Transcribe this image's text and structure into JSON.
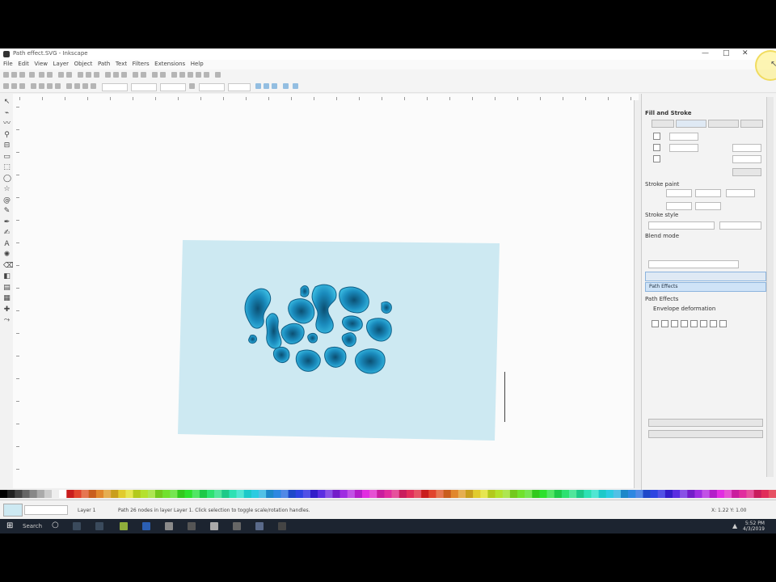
{
  "window": {
    "title": "Path effect.SVG - Inkscape",
    "controls": [
      "—",
      "□",
      "✕"
    ]
  },
  "menu": [
    "File",
    "Edit",
    "View",
    "Layer",
    "Object",
    "Path",
    "Text",
    "Filters",
    "Extensions",
    "Help"
  ],
  "colors": {
    "page_fill": "#cde9f2",
    "shape_dark": "#0b4f72",
    "shape_mid": "#1a8bbd",
    "shape_light": "#3fc3e8",
    "taskbar": "#1c2430",
    "selection_blue": "#cfe3f7"
  },
  "toolbox": {
    "tools": [
      "select-icon",
      "node-icon",
      "tweak-icon",
      "zoom-icon",
      "measure-icon",
      "rect-icon",
      "3dbox-icon",
      "ellipse-icon",
      "star-icon",
      "spiral-icon",
      "pencil-icon",
      "pen-icon",
      "calligraphy-icon",
      "text-icon",
      "spray-icon",
      "eraser-icon",
      "bucket-icon",
      "gradient-icon",
      "mesh-icon",
      "dropper-icon",
      "connector-icon"
    ]
  },
  "dock": {
    "panel_title": "Fill and Stroke",
    "section_a": "Stroke paint",
    "section_b": "Stroke style",
    "section_c": "Blend mode",
    "row_selected": "Path Effects",
    "effects_header": "Path Effects",
    "effect_label": "Envelope deformation"
  },
  "status": {
    "layer_label": "Layer 1",
    "message": "Path 26 nodes in layer Layer 1. Click selection to toggle scale/rotation handles.",
    "coords": "X: 1.22  Y: 1.00"
  },
  "taskbar": {
    "search_label": "Search",
    "time": "5:52 PM",
    "date": "4/3/2019"
  }
}
